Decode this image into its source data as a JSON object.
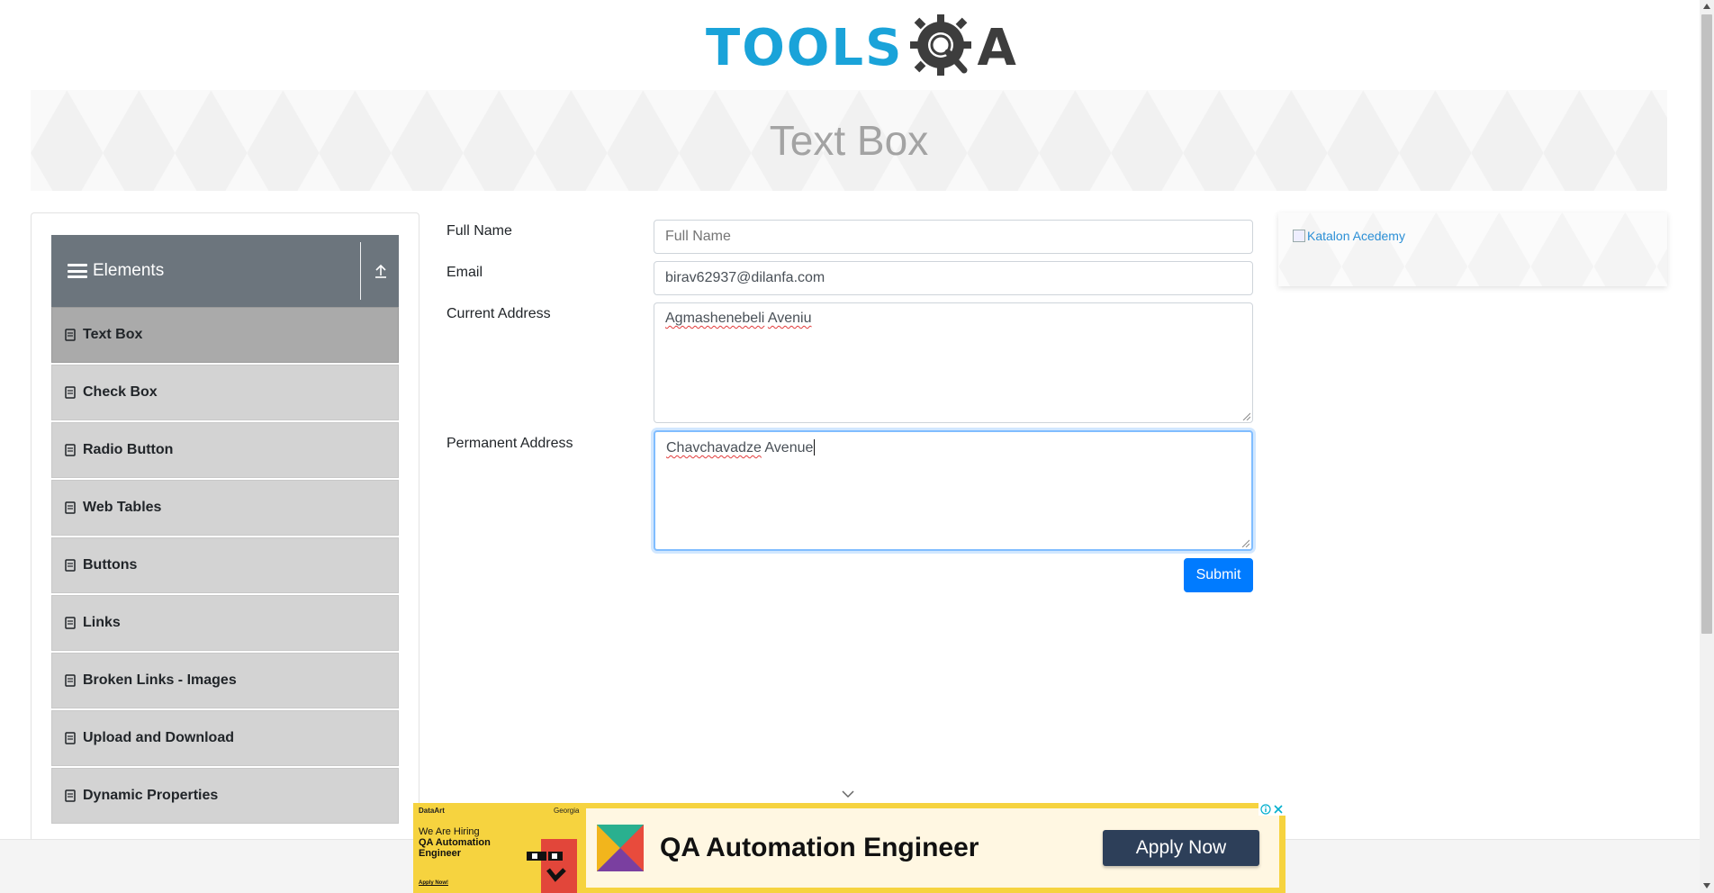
{
  "header": {
    "logo_text_left": "TOOLS",
    "logo_text_right": "A",
    "logo_icon": "gear-magnifier-icon"
  },
  "banner": {
    "title": "Text Box"
  },
  "sidebar": {
    "group_title": "Elements",
    "group_icon": "hamburger-icon",
    "collapse_icon": "collapse-arrow-icon",
    "items": [
      {
        "label": "Text Box",
        "active": true
      },
      {
        "label": "Check Box",
        "active": false
      },
      {
        "label": "Radio Button",
        "active": false
      },
      {
        "label": "Web Tables",
        "active": false
      },
      {
        "label": "Buttons",
        "active": false
      },
      {
        "label": "Links",
        "active": false
      },
      {
        "label": "Broken Links - Images",
        "active": false
      },
      {
        "label": "Upload and Download",
        "active": false
      },
      {
        "label": "Dynamic Properties",
        "active": false
      }
    ]
  },
  "form": {
    "full_name": {
      "label": "Full Name",
      "value": "",
      "placeholder": "Full Name"
    },
    "email": {
      "label": "Email",
      "value": "birav62937@dilanfa.com"
    },
    "current_address": {
      "label": "Current Address",
      "value_part1": "Agmashenebeli",
      "value_part2": "Aveniu"
    },
    "permanent_address": {
      "label": "Permanent Address",
      "value_part1": "Chavchavadze",
      "value_part2": " Avenue"
    },
    "submit_label": "Submit"
  },
  "side_ad": {
    "alt_text": "Katalon Acedemy"
  },
  "bottom_ad": {
    "brand": "DataArt",
    "region": "Georgia",
    "hiring_line1": "We Are Hiring",
    "hiring_line2": "QA Automation",
    "hiring_line3": "Engineer",
    "small_cta": "Apply Now!",
    "title": "QA Automation Engineer",
    "cta": "Apply Now"
  },
  "colors": {
    "brand_blue": "#1aa3d9",
    "primary_button": "#007bff",
    "sidebar_header": "#6c757d",
    "menu_item_bg": "#d3d3d3",
    "menu_item_active": "#aaaaaa",
    "ad_yellow": "#f6d33f",
    "ad_button": "#2d3f59"
  }
}
